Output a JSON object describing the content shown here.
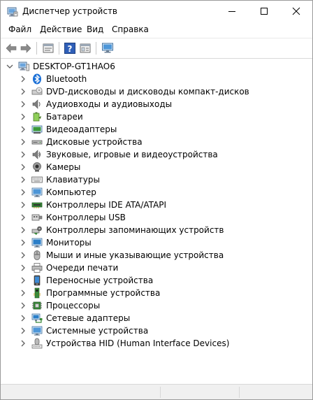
{
  "window": {
    "title": "Диспетчер устройств"
  },
  "menu": {
    "items": [
      "Файл",
      "Действие",
      "Вид",
      "Справка"
    ]
  },
  "toolbar": {
    "buttons": [
      "back-arrow-icon",
      "forward-arrow-icon",
      "properties-icon",
      "help-icon",
      "view-icon",
      "monitor-icon"
    ]
  },
  "tree": {
    "root_label": "DESKTOP-GT1HAO6",
    "items": [
      {
        "label": "Bluetooth",
        "icon": "bluetooth-icon"
      },
      {
        "label": "DVD-дисководы и дисководы компакт-дисков",
        "icon": "dvd-drive-icon"
      },
      {
        "label": "Аудиовходы и аудиовыходы",
        "icon": "speaker-icon"
      },
      {
        "label": "Батареи",
        "icon": "battery-icon"
      },
      {
        "label": "Видеоадаптеры",
        "icon": "display-adapter-icon"
      },
      {
        "label": "Дисковые устройства",
        "icon": "disk-drive-icon"
      },
      {
        "label": "Звуковые, игровые и видеоустройства",
        "icon": "sound-device-icon"
      },
      {
        "label": "Камеры",
        "icon": "camera-icon"
      },
      {
        "label": "Клавиатуры",
        "icon": "keyboard-icon"
      },
      {
        "label": "Компьютер",
        "icon": "computer-icon"
      },
      {
        "label": "Контроллеры IDE ATA/ATAPI",
        "icon": "ide-controller-icon"
      },
      {
        "label": "Контроллеры USB",
        "icon": "usb-controller-icon"
      },
      {
        "label": "Контроллеры запоминающих устройств",
        "icon": "storage-controller-icon"
      },
      {
        "label": "Мониторы",
        "icon": "monitor-icon"
      },
      {
        "label": "Мыши и иные указывающие устройства",
        "icon": "mouse-icon"
      },
      {
        "label": "Очереди печати",
        "icon": "printer-icon"
      },
      {
        "label": "Переносные устройства",
        "icon": "portable-device-icon"
      },
      {
        "label": "Программные устройства",
        "icon": "software-device-icon"
      },
      {
        "label": "Процессоры",
        "icon": "processor-icon"
      },
      {
        "label": "Сетевые адаптеры",
        "icon": "network-adapter-icon"
      },
      {
        "label": "Системные устройства",
        "icon": "system-device-icon"
      },
      {
        "label": "Устройства HID (Human Interface Devices)",
        "icon": "hid-device-icon"
      }
    ]
  },
  "colors": {
    "bluetooth": "#1a6fd6",
    "monitor": "#2a7ec8",
    "chevron": "#5f5f5f"
  }
}
